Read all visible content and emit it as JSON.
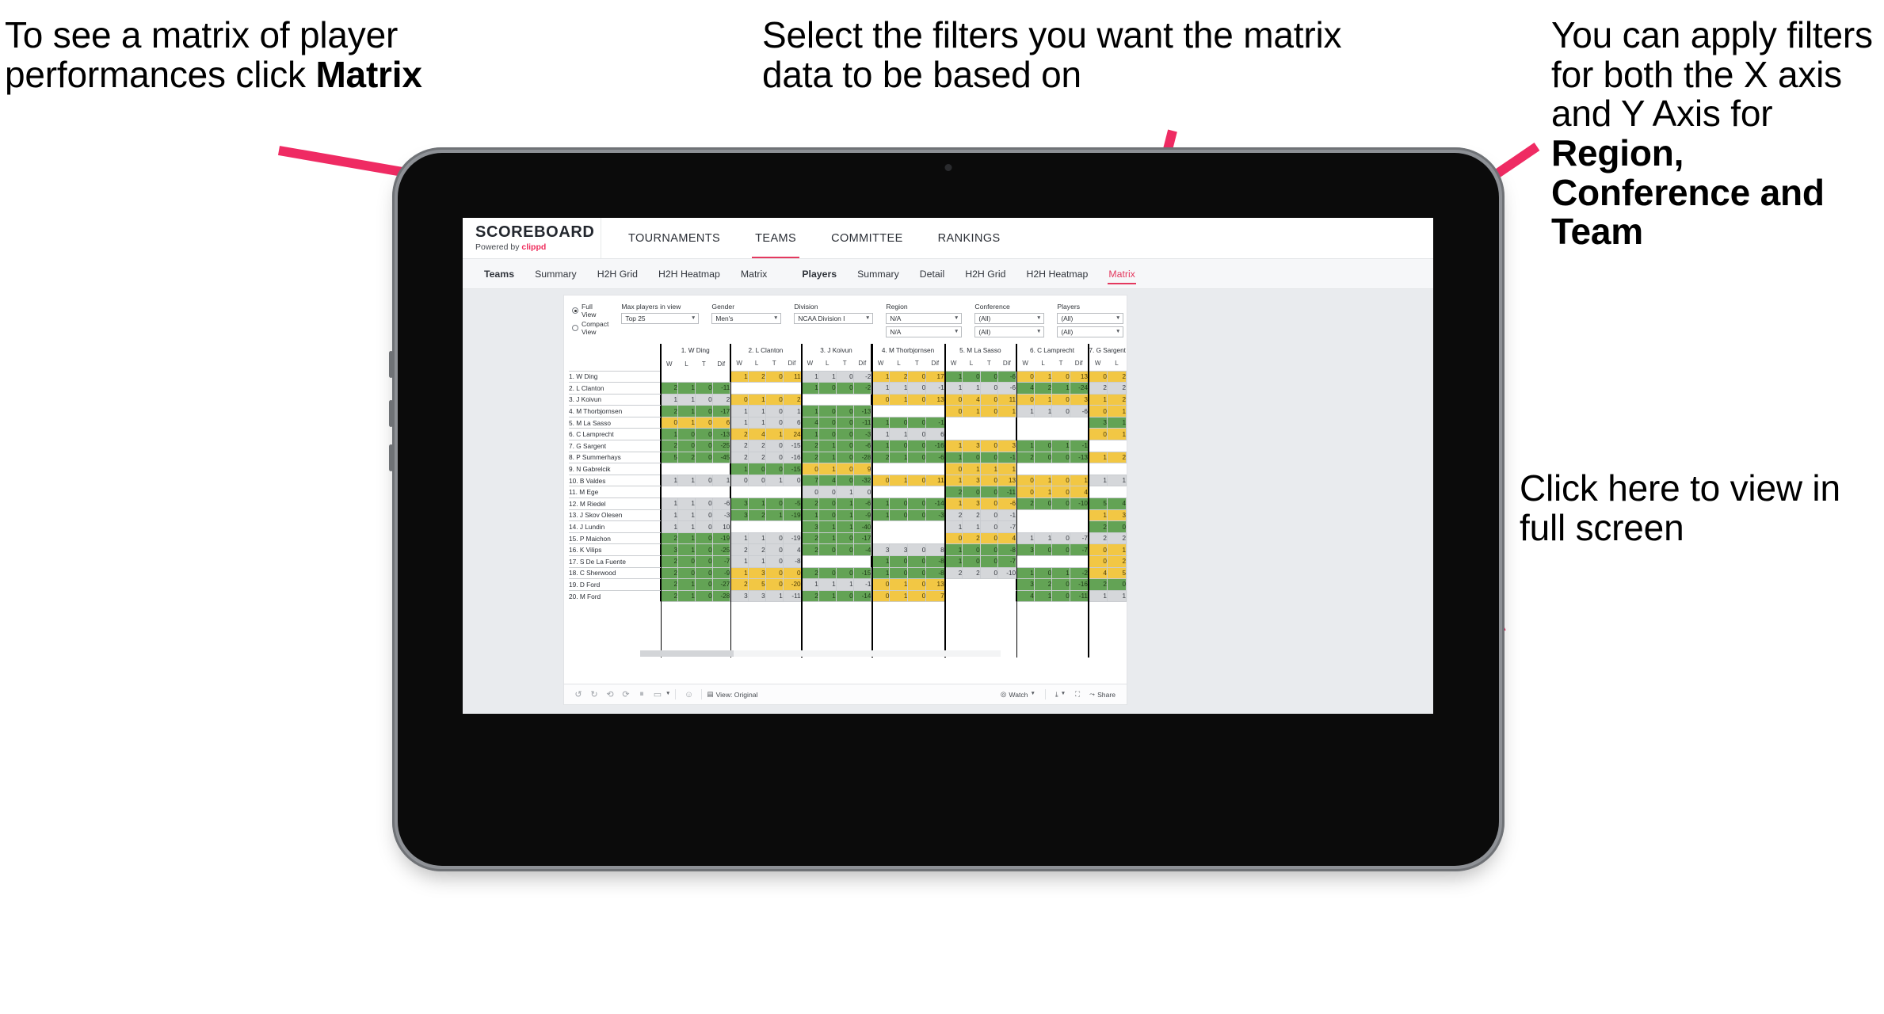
{
  "annotations": {
    "left": {
      "pre": "To see a matrix of player performances click ",
      "bold": "Matrix"
    },
    "middle": {
      "text": "Select the filters you want the matrix data to be based on"
    },
    "right": {
      "pre": "You  can apply filters for both the X axis and Y Axis for ",
      "bold": "Region, Conference and Team"
    },
    "fullscreen": {
      "text": "Click here to view in full screen"
    }
  },
  "colors": {
    "accent_pink": "#ef2b5b",
    "arrow_pink": "#ef2b63",
    "green": "#63a355",
    "gold": "#f2c744",
    "grey": "#d5d7da"
  },
  "app": {
    "brand": {
      "title": "SCOREBOARD",
      "sub_pre": "Powered by ",
      "sub_brand": "clippd"
    },
    "top_nav": [
      "TOURNAMENTS",
      "TEAMS",
      "COMMITTEE",
      "RANKINGS"
    ],
    "top_nav_active": "TEAMS",
    "sub_nav_teams": [
      "Teams",
      "Summary",
      "H2H Grid",
      "H2H Heatmap",
      "Matrix"
    ],
    "sub_nav_players": [
      "Players",
      "Summary",
      "Detail",
      "H2H Grid",
      "H2H Heatmap",
      "Matrix"
    ],
    "sub_nav_selected": "Matrix"
  },
  "filters": {
    "view_mode": {
      "options": [
        "Full View",
        "Compact View"
      ],
      "selected": "Full View"
    },
    "controls": [
      {
        "label": "Max players in view",
        "value": "Top 25"
      },
      {
        "label": "Gender",
        "value": "Men's"
      },
      {
        "label": "Division",
        "value": "NCAA Division I"
      },
      {
        "label": "Region",
        "value": "N/A",
        "value2": "N/A"
      },
      {
        "label": "Conference",
        "value": "(All)",
        "value2": "(All)"
      },
      {
        "label": "Players",
        "value": "(All)",
        "value2": "(All)"
      }
    ]
  },
  "viz_toolbar": {
    "icons": [
      "undo-icon",
      "redo-icon",
      "revert-icon",
      "refresh-icon",
      "pause-icon",
      "device-layout-icon"
    ],
    "view_label": "View: Original",
    "watch_label": "Watch",
    "share_label": "Share"
  },
  "chart_data": {
    "type": "table",
    "title": "Head-to-head player performance matrix",
    "sub_headers": [
      "W",
      "L",
      "T",
      "Dif"
    ],
    "columns": [
      "1. W Ding",
      "2. L Clanton",
      "3. J Koivun",
      "4. M Thorbjornsen",
      "5. M La Sasso",
      "6. C Lamprecht",
      "7. G Sargent"
    ],
    "rows": [
      "1. W Ding",
      "2. L Clanton",
      "3. J Koivun",
      "4. M Thorbjornsen",
      "5. M La Sasso",
      "6. C Lamprecht",
      "7. G Sargent",
      "8. P Summerhays",
      "9. N Gabrelcik",
      "10. B Valdes",
      "11. M Ege",
      "12. M Riedel",
      "13. J Skov Olesen",
      "14. J Lundin",
      "15. P Maichon",
      "16. K Vilips",
      "17. S De La Fuente",
      "18. C Sherwood",
      "19. D Ford",
      "20. M Ford"
    ],
    "cells": [
      [
        null,
        [
          "1",
          "2",
          "0",
          "11",
          "gold"
        ],
        [
          "1",
          "1",
          "0",
          "-2",
          "grey"
        ],
        [
          "1",
          "2",
          "0",
          "17",
          "gold"
        ],
        [
          "1",
          "0",
          "0",
          "-6",
          "green"
        ],
        [
          "0",
          "1",
          "0",
          "13",
          "gold"
        ],
        [
          "0",
          "2",
          "",
          "",
          "gold"
        ]
      ],
      [
        [
          "2",
          "1",
          "0",
          "-11",
          "green"
        ],
        null,
        [
          "1",
          "0",
          "0",
          "-2",
          "green"
        ],
        [
          "1",
          "1",
          "0",
          "-1",
          "grey"
        ],
        [
          "1",
          "1",
          "0",
          "-6",
          "grey"
        ],
        [
          "4",
          "2",
          "1",
          "-24",
          "green"
        ],
        [
          "2",
          "2",
          "",
          "",
          "grey"
        ]
      ],
      [
        [
          "1",
          "1",
          "0",
          "2",
          "grey"
        ],
        [
          "0",
          "1",
          "0",
          "2",
          "gold"
        ],
        null,
        [
          "0",
          "1",
          "0",
          "13",
          "gold"
        ],
        [
          "0",
          "4",
          "0",
          "11",
          "gold"
        ],
        [
          "0",
          "1",
          "0",
          "3",
          "gold"
        ],
        [
          "1",
          "2",
          "",
          "",
          "gold"
        ]
      ],
      [
        [
          "2",
          "1",
          "0",
          "-17",
          "green"
        ],
        [
          "1",
          "1",
          "0",
          "1",
          "grey"
        ],
        [
          "1",
          "0",
          "0",
          "-13",
          "green"
        ],
        null,
        [
          "0",
          "1",
          "0",
          "1",
          "gold"
        ],
        [
          "1",
          "1",
          "0",
          "-6",
          "grey"
        ],
        [
          "0",
          "1",
          "",
          "",
          "gold"
        ]
      ],
      [
        [
          "0",
          "1",
          "0",
          "6",
          "gold"
        ],
        [
          "1",
          "1",
          "0",
          "6",
          "grey"
        ],
        [
          "4",
          "0",
          "0",
          "-11",
          "green"
        ],
        [
          "1",
          "0",
          "0",
          "-1",
          "green"
        ],
        null,
        null,
        [
          "3",
          "1",
          "",
          "",
          "green"
        ]
      ],
      [
        [
          "1",
          "0",
          "0",
          "-13",
          "green"
        ],
        [
          "2",
          "4",
          "1",
          "24",
          "gold"
        ],
        [
          "1",
          "0",
          "0",
          "-3",
          "green"
        ],
        [
          "1",
          "1",
          "0",
          "6",
          "grey"
        ],
        null,
        null,
        [
          "0",
          "1",
          "",
          "",
          "gold"
        ]
      ],
      [
        [
          "2",
          "0",
          "0",
          "-25",
          "green"
        ],
        [
          "2",
          "2",
          "0",
          "-15",
          "grey"
        ],
        [
          "2",
          "1",
          "0",
          "-6",
          "green"
        ],
        [
          "1",
          "0",
          "0",
          "-16",
          "green"
        ],
        [
          "1",
          "3",
          "0",
          "3",
          "gold"
        ],
        [
          "1",
          "0",
          "1",
          "-1",
          "green"
        ],
        null
      ],
      [
        [
          "5",
          "2",
          "0",
          "-45",
          "green"
        ],
        [
          "2",
          "2",
          "0",
          "-16",
          "grey"
        ],
        [
          "2",
          "1",
          "0",
          "-28",
          "green"
        ],
        [
          "2",
          "1",
          "0",
          "-6",
          "green"
        ],
        [
          "1",
          "0",
          "0",
          "-1",
          "green"
        ],
        [
          "2",
          "0",
          "0",
          "-13",
          "green"
        ],
        [
          "1",
          "2",
          "",
          "",
          "gold"
        ]
      ],
      [
        null,
        [
          "1",
          "0",
          "0",
          "-15",
          "green"
        ],
        [
          "0",
          "1",
          "0",
          "9",
          "gold"
        ],
        null,
        [
          "0",
          "1",
          "1",
          "1",
          "gold"
        ],
        null,
        null
      ],
      [
        [
          "1",
          "1",
          "0",
          "1",
          "grey"
        ],
        [
          "0",
          "0",
          "1",
          "0",
          "grey"
        ],
        [
          "7",
          "4",
          "0",
          "-32",
          "green"
        ],
        [
          "0",
          "1",
          "0",
          "11",
          "gold"
        ],
        [
          "1",
          "3",
          "0",
          "13",
          "gold"
        ],
        [
          "0",
          "1",
          "0",
          "1",
          "gold"
        ],
        [
          "1",
          "1",
          "",
          "",
          "grey"
        ]
      ],
      [
        null,
        null,
        [
          "0",
          "0",
          "1",
          "0",
          "grey"
        ],
        null,
        [
          "2",
          "0",
          "0",
          "-11",
          "green"
        ],
        [
          "0",
          "1",
          "0",
          "4",
          "gold"
        ],
        null
      ],
      [
        [
          "1",
          "1",
          "0",
          "-6",
          "grey"
        ],
        [
          "3",
          "1",
          "0",
          "-5",
          "green"
        ],
        [
          "2",
          "0",
          "1",
          "-6",
          "green"
        ],
        [
          "1",
          "0",
          "0",
          "-14",
          "green"
        ],
        [
          "1",
          "3",
          "0",
          "-6",
          "gold"
        ],
        [
          "2",
          "0",
          "0",
          "-10",
          "green"
        ],
        [
          "5",
          "4",
          "",
          "",
          "green"
        ]
      ],
      [
        [
          "1",
          "1",
          "0",
          "-3",
          "grey"
        ],
        [
          "3",
          "2",
          "1",
          "-19",
          "green"
        ],
        [
          "1",
          "0",
          "1",
          "-9",
          "green"
        ],
        [
          "1",
          "0",
          "0",
          "-3",
          "green"
        ],
        [
          "2",
          "2",
          "0",
          "-1",
          "grey"
        ],
        null,
        [
          "1",
          "3",
          "",
          "",
          "gold"
        ]
      ],
      [
        [
          "1",
          "1",
          "0",
          "10",
          "grey"
        ],
        null,
        [
          "3",
          "1",
          "1",
          "-40",
          "green"
        ],
        null,
        [
          "1",
          "1",
          "0",
          "-7",
          "grey"
        ],
        null,
        [
          "2",
          "0",
          "",
          "",
          "green"
        ]
      ],
      [
        [
          "2",
          "1",
          "0",
          "-19",
          "green"
        ],
        [
          "1",
          "1",
          "0",
          "-19",
          "grey"
        ],
        [
          "2",
          "1",
          "0",
          "-17",
          "green"
        ],
        null,
        [
          "0",
          "2",
          "0",
          "4",
          "gold"
        ],
        [
          "1",
          "1",
          "0",
          "-7",
          "grey"
        ],
        [
          "2",
          "2",
          "",
          "",
          "grey"
        ]
      ],
      [
        [
          "3",
          "1",
          "0",
          "-25",
          "green"
        ],
        [
          "2",
          "2",
          "0",
          "4",
          "grey"
        ],
        [
          "2",
          "0",
          "0",
          "-4",
          "green"
        ],
        [
          "3",
          "3",
          "0",
          "8",
          "grey"
        ],
        [
          "1",
          "0",
          "0",
          "-8",
          "green"
        ],
        [
          "3",
          "0",
          "0",
          "-7",
          "green"
        ],
        [
          "0",
          "1",
          "",
          "",
          "gold"
        ]
      ],
      [
        [
          "2",
          "0",
          "0",
          "-7",
          "green"
        ],
        [
          "1",
          "1",
          "0",
          "-8",
          "grey"
        ],
        null,
        [
          "1",
          "0",
          "0",
          "-8",
          "green"
        ],
        [
          "1",
          "0",
          "0",
          "-7",
          "green"
        ],
        null,
        [
          "0",
          "2",
          "",
          "",
          "gold"
        ]
      ],
      [
        [
          "2",
          "0",
          "0",
          "-9",
          "green"
        ],
        [
          "1",
          "3",
          "0",
          "0",
          "gold"
        ],
        [
          "2",
          "0",
          "0",
          "-15",
          "green"
        ],
        [
          "1",
          "0",
          "0",
          "-8",
          "green"
        ],
        [
          "2",
          "2",
          "0",
          "-10",
          "grey"
        ],
        [
          "1",
          "0",
          "1",
          "-2",
          "green"
        ],
        [
          "4",
          "5",
          "",
          "",
          "gold"
        ]
      ],
      [
        [
          "2",
          "1",
          "0",
          "-27",
          "green"
        ],
        [
          "2",
          "5",
          "0",
          "-20",
          "gold"
        ],
        [
          "1",
          "1",
          "1",
          "-1",
          "grey"
        ],
        [
          "0",
          "1",
          "0",
          "13",
          "gold"
        ],
        null,
        [
          "3",
          "2",
          "0",
          "-16",
          "green"
        ],
        [
          "2",
          "0",
          "",
          "",
          "green"
        ]
      ],
      [
        [
          "2",
          "1",
          "0",
          "-28",
          "green"
        ],
        [
          "3",
          "3",
          "1",
          "-11",
          "grey"
        ],
        [
          "2",
          "1",
          "0",
          "-14",
          "green"
        ],
        [
          "0",
          "1",
          "0",
          "7",
          "gold"
        ],
        null,
        [
          "4",
          "1",
          "0",
          "-11",
          "green"
        ],
        [
          "1",
          "1",
          "",
          "",
          "grey"
        ]
      ]
    ]
  }
}
